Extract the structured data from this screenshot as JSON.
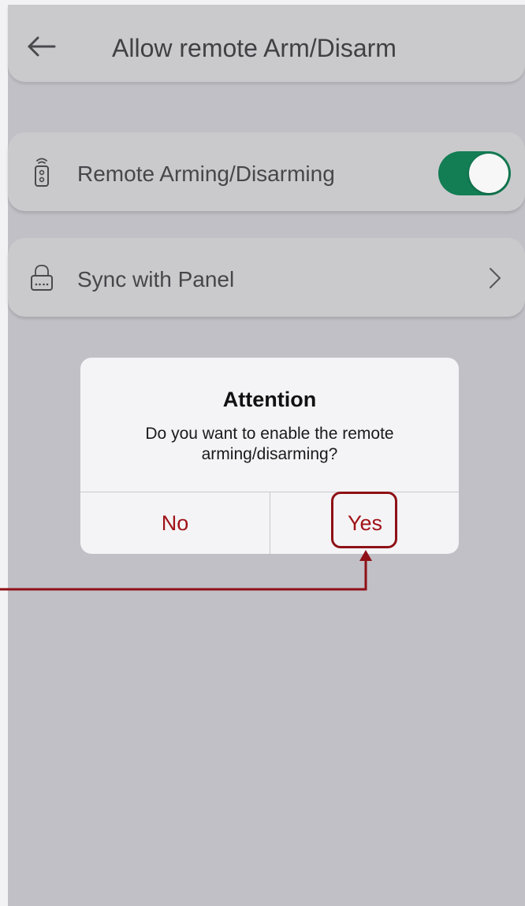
{
  "header": {
    "title": "Allow remote Arm/Disarm",
    "back_icon": "arrow-left-icon"
  },
  "settings": {
    "remote": {
      "label": "Remote Arming/Disarming",
      "icon": "remote-control-icon",
      "toggle_on": true,
      "toggle_color": "#137d54"
    },
    "sync": {
      "label": "Sync with Panel",
      "icon": "panel-keypad-icon",
      "chevron_icon": "chevron-right-icon"
    }
  },
  "dialog": {
    "title": "Attention",
    "message": "Do you want to enable the remote arming/disarming?",
    "no_label": "No",
    "yes_label": "Yes",
    "button_color": "#a01218"
  },
  "annotation": {
    "highlight_color": "#8e1016",
    "target": "Yes"
  }
}
